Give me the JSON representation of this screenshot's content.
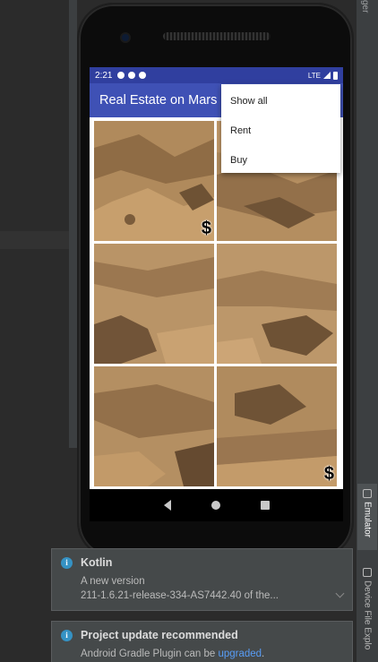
{
  "ide": {
    "top_right_label": "ger",
    "side_tabs": [
      {
        "label": "Emulator",
        "active": true
      },
      {
        "label": "Device File Explo",
        "active": false
      }
    ]
  },
  "device": {
    "status_bar": {
      "time": "2:21",
      "network": "LTE"
    },
    "app_bar": {
      "title": "Real Estate on Mars"
    },
    "overflow_menu": {
      "items": [
        "Show all",
        "Rent",
        "Buy"
      ]
    },
    "grid": {
      "tiles": [
        {
          "badge": "$"
        },
        {
          "badge": ""
        },
        {
          "badge": ""
        },
        {
          "badge": ""
        },
        {
          "badge": ""
        },
        {
          "badge": "$"
        }
      ]
    },
    "nav_bar": {
      "buttons": [
        "back-icon",
        "home-icon",
        "recents-icon"
      ]
    }
  },
  "notifications": [
    {
      "title": "Kotlin",
      "lines": [
        "A new version",
        "211-1.6.21-release-334-AS7442.40 of the..."
      ]
    },
    {
      "title": "Project update recommended",
      "text_prefix": "Android Gradle Plugin can be ",
      "link": "upgraded",
      "text_suffix": "."
    }
  ],
  "colors": {
    "status_bar": "#303f9f",
    "app_bar": "#3f51b5",
    "ide_background": "#2b2b2b",
    "notification_bg": "#45494a",
    "link": "#589df6"
  }
}
